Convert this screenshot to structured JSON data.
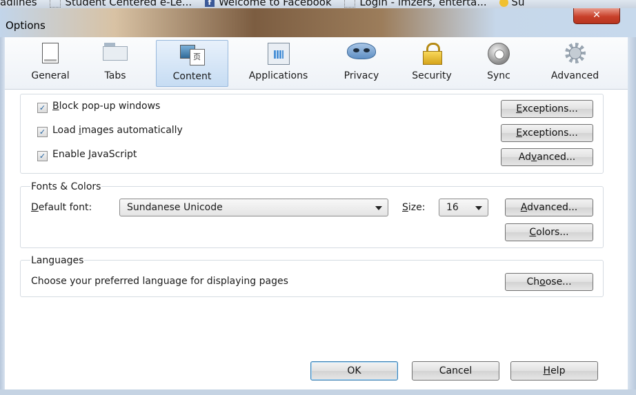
{
  "bookmarks": [
    {
      "label": "adlines"
    },
    {
      "label": "Student Centered e-Le..."
    },
    {
      "label": "Welcome to Facebook"
    },
    {
      "label": "Login - imzers, enterta..."
    },
    {
      "label": "Su"
    }
  ],
  "window": {
    "title": "Options",
    "close_glyph": "✕"
  },
  "toolbar": {
    "items": [
      {
        "id": "general",
        "label": "General"
      },
      {
        "id": "tabs",
        "label": "Tabs"
      },
      {
        "id": "content",
        "label": "Content",
        "selected": true
      },
      {
        "id": "applications",
        "label": "Applications"
      },
      {
        "id": "privacy",
        "label": "Privacy"
      },
      {
        "id": "security",
        "label": "Security"
      },
      {
        "id": "sync",
        "label": "Sync"
      },
      {
        "id": "advanced",
        "label": "Advanced"
      }
    ]
  },
  "content": {
    "block_popups": {
      "mn": "B",
      "rest": "lock pop-up windows",
      "checked": true,
      "button_mn": "E",
      "button_rest": "xceptions..."
    },
    "load_images": {
      "pre": "Load ",
      "mn": "i",
      "rest": "mages automatically",
      "checked": true,
      "button_mn": "E",
      "button_rest": "xceptions..."
    },
    "javascript": {
      "pre": "Enable ",
      "mn": "J",
      "rest": "avaScript",
      "checked": true,
      "button_pre": "Ad",
      "button_mn": "v",
      "button_rest": "anced..."
    },
    "check_glyph": "✓"
  },
  "fonts": {
    "legend": "Fonts & Colors",
    "default_font_mn": "D",
    "default_font_rest": "efault font:",
    "default_font_value": "Sundanese Unicode",
    "size_mn": "S",
    "size_rest": "ize:",
    "size_value": "16",
    "advanced_mn": "A",
    "advanced_rest": "dvanced...",
    "colors_mn": "C",
    "colors_rest": "olors..."
  },
  "languages": {
    "legend": "Languages",
    "description": "Choose your preferred language for displaying pages",
    "choose_pre": "Ch",
    "choose_mn": "o",
    "choose_rest": "ose..."
  },
  "footer": {
    "ok": "OK",
    "cancel": "Cancel",
    "help_mn": "H",
    "help_rest": "elp"
  }
}
